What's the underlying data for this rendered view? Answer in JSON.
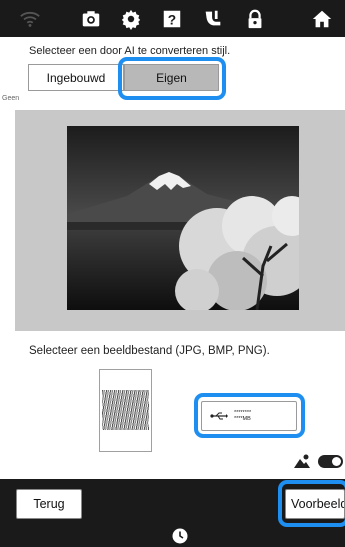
{
  "topbar": {
    "icons": [
      "wifi-icon",
      "camera-icon",
      "settings-gear-icon",
      "help-question-icon",
      "embroidery-foot-icon",
      "lock-icon",
      "home-icon"
    ]
  },
  "style_select": {
    "instruction": "Selecteer een door AI te converteren stijl.",
    "tab_builtin": "Ingebouwd",
    "tab_custom": "Eigen",
    "selected": "Eigen"
  },
  "preview": {
    "style_name": "Geen"
  },
  "file_select": {
    "instruction": "Selecteer een beeldbestand (JPG, BMP, PNG).",
    "usb_line1": "********",
    "usb_line2": "****MB"
  },
  "controls": {
    "toggle_on": true
  },
  "footer": {
    "back_label": "Terug",
    "preview_label": "Voorbeeld"
  },
  "colors": {
    "highlight": "#1e8ff0",
    "bar": "#1a1a1a"
  }
}
